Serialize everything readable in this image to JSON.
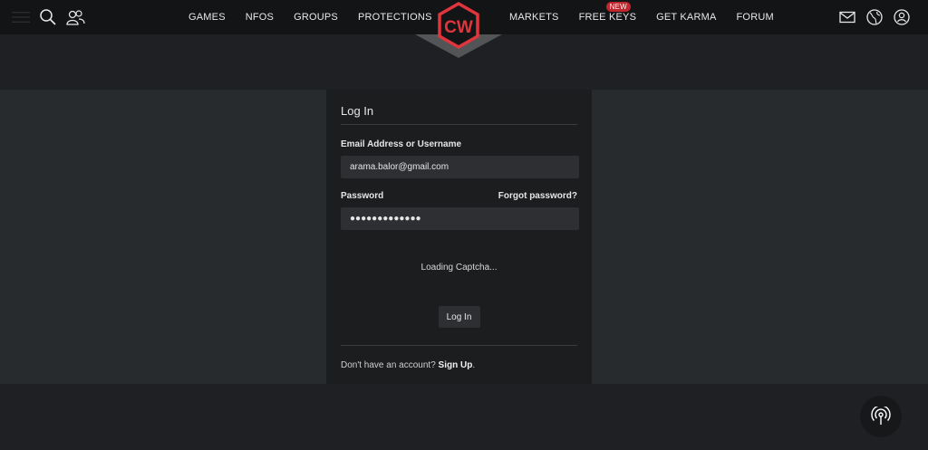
{
  "nav": {
    "left_links": [
      "GAMES",
      "NFOS",
      "GROUPS",
      "PROTECTIONS"
    ],
    "right_links": [
      "MARKETS",
      "FREE KEYS",
      "GET KARMA",
      "FORUM"
    ],
    "new_badge": "NEW",
    "logo_text": "CW",
    "icons": [
      "menu-icon",
      "search-icon",
      "users-icon",
      "mail-icon",
      "globe-icon",
      "user-icon"
    ],
    "accent": "#e0353c"
  },
  "login": {
    "title": "Log In",
    "email_label": "Email Address or Username",
    "email_value": "arama.balor@gmail.com",
    "password_label": "Password",
    "forgot_label": "Forgot password?",
    "password_value": "●●●●●●●●●●●●●",
    "captcha_text": "Loading Captcha...",
    "submit_label": "Log In",
    "no_account_text": "Don't have an account?",
    "signup_label": "Sign Up",
    "signup_suffix": "."
  },
  "fab": {
    "icon": "broadcast-icon"
  }
}
